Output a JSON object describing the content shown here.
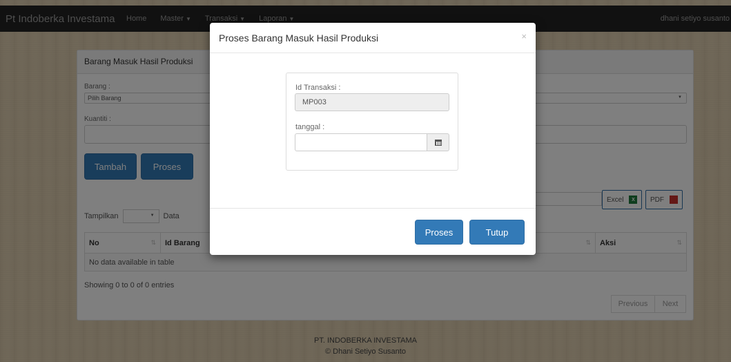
{
  "navbar": {
    "brand": "Pt Indoberka Investama",
    "items": [
      {
        "label": "Home",
        "caret": false
      },
      {
        "label": "Master",
        "caret": true
      },
      {
        "label": "Transaksi",
        "caret": true
      },
      {
        "label": "Laporan",
        "caret": true
      }
    ],
    "user": "dhani setiyo susanto",
    "caret_glyph": "▼"
  },
  "panel": {
    "heading": "Barang Masuk Hasil Produksi",
    "barang_label": "Barang :",
    "barang_placeholder": "Pilih Barang",
    "kuantiti_label": "Kuantiti :",
    "tambah_label": "Tambah",
    "proses_label": "Proses",
    "excel_label": "Excel",
    "xls_glyph": "X",
    "pdf_label": "PDF",
    "tampilkan_label": "Tampilkan",
    "data_label": "Data",
    "table": {
      "columns": [
        "No",
        "Id Barang",
        "Aksi"
      ],
      "empty": "No data available in table"
    },
    "showing": "Showing 0 to 0 of 0 entries",
    "previous_label": "Previous",
    "next_label": "Next"
  },
  "footer": {
    "company": "PT. INDOBERKA INVESTAMA",
    "copyright": "© Dhani Setiyo Susanto"
  },
  "modal": {
    "title": "Proses Barang Masuk Hasil Produksi",
    "close_glyph": "×",
    "id_label": "Id Transaksi :",
    "id_value": "MP003",
    "tanggal_label": "tanggal :",
    "tanggal_value": "",
    "proses_label": "Proses",
    "tutup_label": "Tutup"
  },
  "colors": {
    "primary": "#337ab7",
    "navbar": "#222222"
  }
}
